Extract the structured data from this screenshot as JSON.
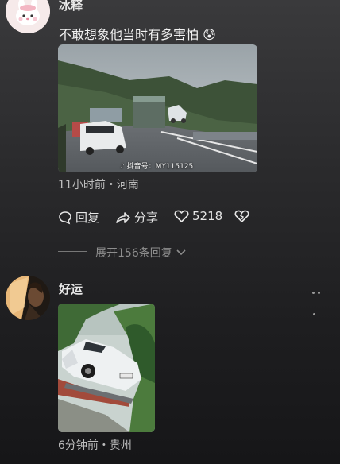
{
  "comment1": {
    "username": "冰释",
    "text": "不敢想象他当时有多害怕",
    "emoji": "😰",
    "watermark": "抖音号：MY115125",
    "meta": "11小时前・河南",
    "reply_label": "回复",
    "share_label": "分享",
    "like_count": "5218",
    "expand_replies": "展开156条回复"
  },
  "comment2": {
    "username": "好运",
    "meta": "6分钟前・贵州"
  }
}
